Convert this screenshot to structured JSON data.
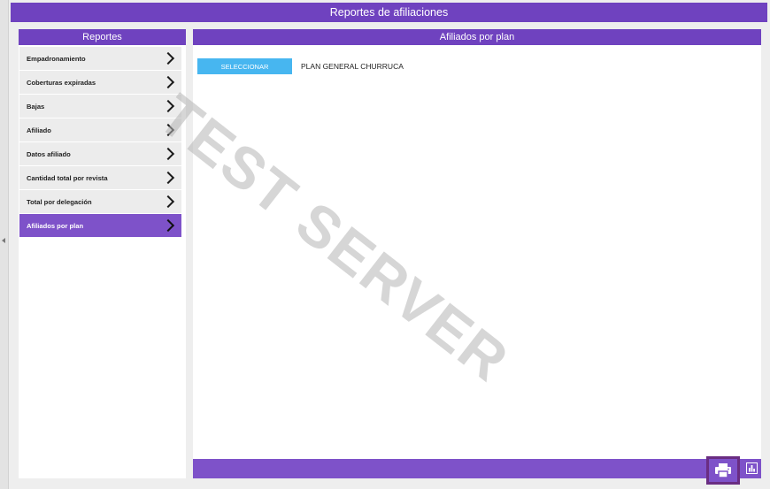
{
  "app": {
    "title": "Reportes de afiliaciones"
  },
  "sidebar": {
    "title": "Reportes",
    "items": [
      {
        "label": "Empadronamiento",
        "active": false
      },
      {
        "label": "Coberturas expiradas",
        "active": false
      },
      {
        "label": "Bajas",
        "active": false
      },
      {
        "label": "Afiliado",
        "active": false
      },
      {
        "label": "Datos afiliado",
        "active": false
      },
      {
        "label": "Cantidad total por revista",
        "active": false
      },
      {
        "label": "Total por delegación",
        "active": false
      },
      {
        "label": "Afiliados por plan",
        "active": true
      }
    ]
  },
  "main": {
    "title": "Afiliados por plan",
    "select_button": "SELECCIONAR",
    "plan_name": "PLAN GENERAL CHURRUCA"
  },
  "watermark": "TEST SERVER",
  "colors": {
    "header": "#6f42bf",
    "active_item": "#7e52c9",
    "select_button": "#47b6f0",
    "print_button_border": "#6a2d82"
  },
  "icons": {
    "print": "printer-icon",
    "chart": "bar-chart-icon",
    "menu_arrow": "chevron-right-icon",
    "collapse": "caret-left-icon"
  }
}
